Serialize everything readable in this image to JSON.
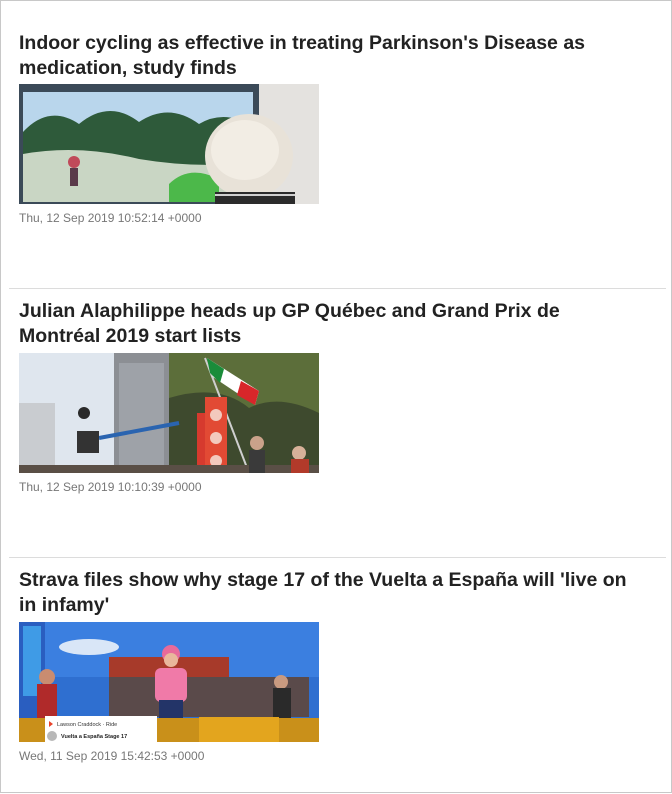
{
  "articles": [
    {
      "title": "Indoor cycling as effective in treating Parkinson's Disease as medication, study finds",
      "date": "Thu, 12 Sep 2019 10:52:14 +0000"
    },
    {
      "title": "Julian Alaphilippe heads up GP Québec and Grand Prix de Montréal 2019 start lists",
      "date": "Thu, 12 Sep 2019 10:10:39 +0000"
    },
    {
      "title": "Strava files show why stage 17 of the Vuelta a España will 'live on in infamy'",
      "date": "Wed, 11 Sep 2019 15:42:53 +0000",
      "thumb_caption_line1": "Lawson Craddock · Ride",
      "thumb_caption_line2": "Vuelta a España Stage 17"
    }
  ]
}
